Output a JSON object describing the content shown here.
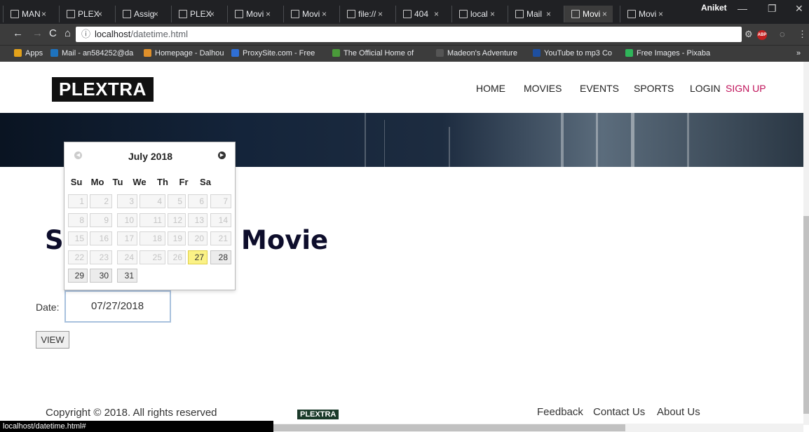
{
  "browser": {
    "tabs": [
      "MAN",
      "PLEX",
      "Assig",
      "PLEX",
      "Movi",
      "Movi",
      "file://",
      "404",
      "local",
      "Mail",
      "Movi",
      "Movi"
    ],
    "active_tab_index": 10,
    "user": "Aniket",
    "url_host": "localhost",
    "url_path": "/datetime.html",
    "bookmarks": [
      "Apps",
      "Mail - an584252@da",
      "Homepage - Dalhou",
      "ProxySite.com - Free",
      "The Official Home of",
      "Madeon's Adventure",
      "YouTube to mp3 Co",
      "Free Images - Pixaba"
    ],
    "status_url": "localhost/datetime.html#"
  },
  "site": {
    "logo": "PLEXTRA",
    "nav": [
      "HOME",
      "MOVIES",
      "EVENTS",
      "SPORTS",
      "LOGIN",
      "SIGN UP"
    ],
    "heading_left": "S",
    "heading_right": "Movie",
    "date_label": "Date:",
    "date_value": "07/27/2018",
    "view_button": "VIEW",
    "copyright": "Copyright © 2018. All rights reserved",
    "footer_logo": "PLEXTRA",
    "footer_links": [
      "Feedback",
      "Contact Us",
      "About Us"
    ]
  },
  "datepicker": {
    "month_title": "July 2018",
    "weekdays": [
      "Su",
      "Mo",
      "Tu",
      "We",
      "Th",
      "Fr",
      "Sa"
    ],
    "days": [
      "1",
      "2",
      "3",
      "4",
      "5",
      "6",
      "7",
      "8",
      "9",
      "10",
      "11",
      "12",
      "13",
      "14",
      "15",
      "16",
      "17",
      "18",
      "19",
      "20",
      "21",
      "22",
      "23",
      "24",
      "25",
      "26",
      "27",
      "28",
      "29",
      "30",
      "31"
    ],
    "highlighted_day": "27",
    "enabled_from_day": 27
  },
  "colors": {
    "signup": "#c0135a",
    "today": "#fbf286",
    "heading": "#0d0d2b"
  }
}
